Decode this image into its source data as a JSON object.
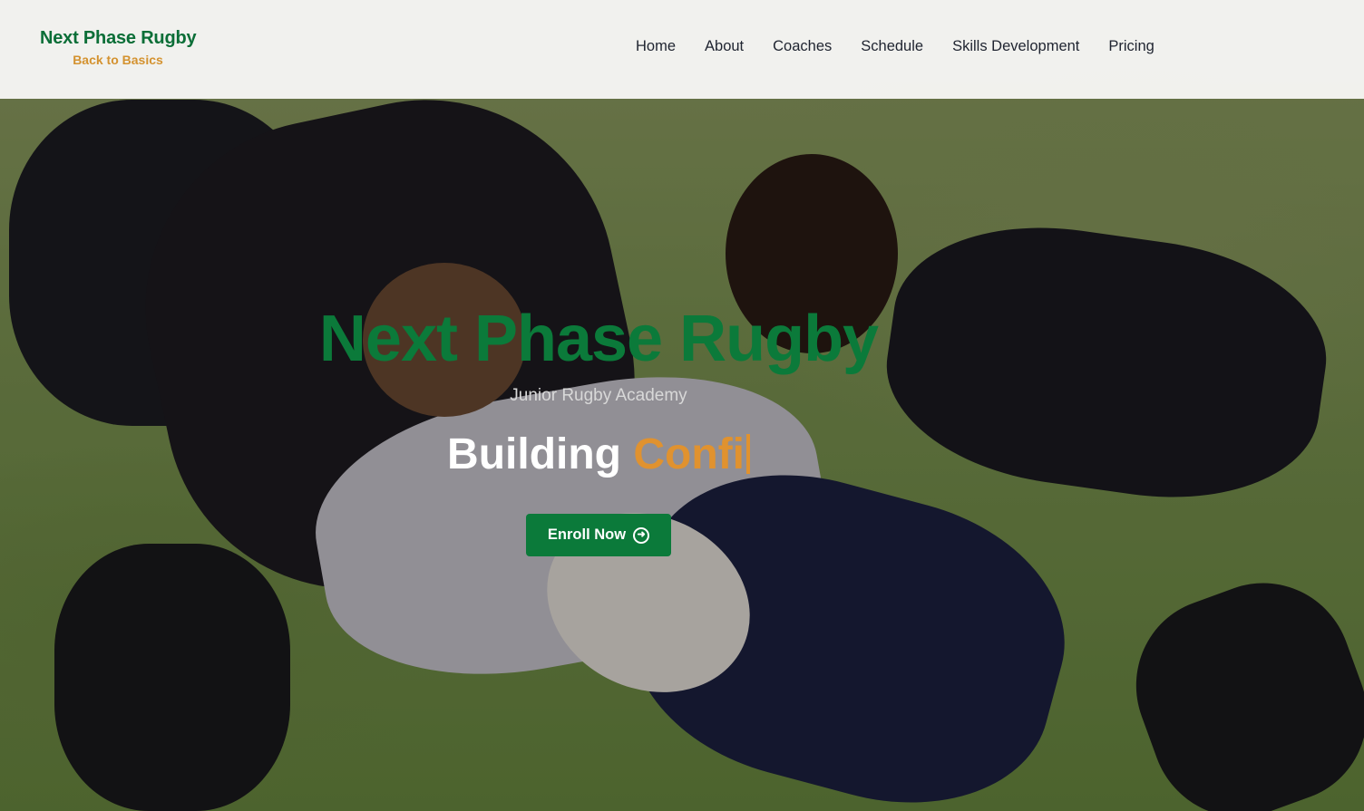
{
  "brand": {
    "title": "Next Phase Rugby",
    "subtitle": "Back to Basics"
  },
  "nav": {
    "items": [
      {
        "label": "Home"
      },
      {
        "label": "About"
      },
      {
        "label": "Coaches"
      },
      {
        "label": "Schedule"
      },
      {
        "label": "Skills Development"
      },
      {
        "label": "Pricing"
      }
    ]
  },
  "hero": {
    "title": "Next Phase Rugby",
    "tagline": "Junior Rugby Academy",
    "typed_static": "Building",
    "typed_dynamic": "Confi",
    "cta_label": "Enroll Now",
    "cta_icon": "arrow-right-circle-icon"
  },
  "colors": {
    "brand_green": "#0b7a3a",
    "accent_orange": "#e0922f",
    "header_bg": "#f7f7f5"
  }
}
